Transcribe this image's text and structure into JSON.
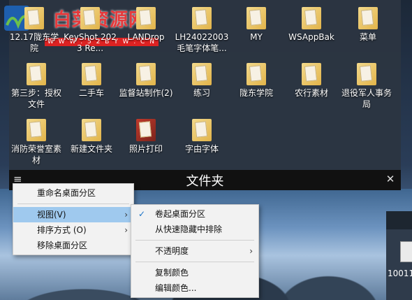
{
  "watermark": {
    "text": "白菜资源网",
    "url": "W W W . 5 2 B Y W . C N"
  },
  "fence": {
    "title": "文件夹"
  },
  "icons": [
    {
      "label": "12.17陇东学院"
    },
    {
      "label": "KeyShot 2023 Re..."
    },
    {
      "label": "LANDrop"
    },
    {
      "label": "LH24022003 毛笔字体笔..."
    },
    {
      "label": "MY"
    },
    {
      "label": "WSAppBak"
    },
    {
      "label": "菜单"
    },
    {
      "label": "第三步：授权文件"
    },
    {
      "label": "二手车"
    },
    {
      "label": "监督站制作(2)"
    },
    {
      "label": "练习"
    },
    {
      "label": "陇东学院"
    },
    {
      "label": "农行素材"
    },
    {
      "label": "退役军人事务局"
    },
    {
      "label": "消防荣誉室素材"
    },
    {
      "label": "新建文件夹"
    },
    {
      "label": "照片打印"
    },
    {
      "label": "字由字体"
    }
  ],
  "menu1": {
    "items": [
      {
        "label": "重命名桌面分区"
      },
      {
        "label": "视图(V)"
      },
      {
        "label": "排序方式 (O)"
      },
      {
        "label": "移除桌面分区"
      }
    ]
  },
  "menu2": {
    "items": [
      {
        "label": "卷起桌面分区"
      },
      {
        "label": "从快速隐藏中排除"
      },
      {
        "label": "不透明度"
      },
      {
        "label": "复制颜色"
      },
      {
        "label": "编辑颜色..."
      }
    ]
  },
  "win2": {
    "label": "10011"
  },
  "icons_glyphs": {
    "menu": "≡",
    "close": "✕",
    "arrow": "›",
    "check": "✓"
  }
}
